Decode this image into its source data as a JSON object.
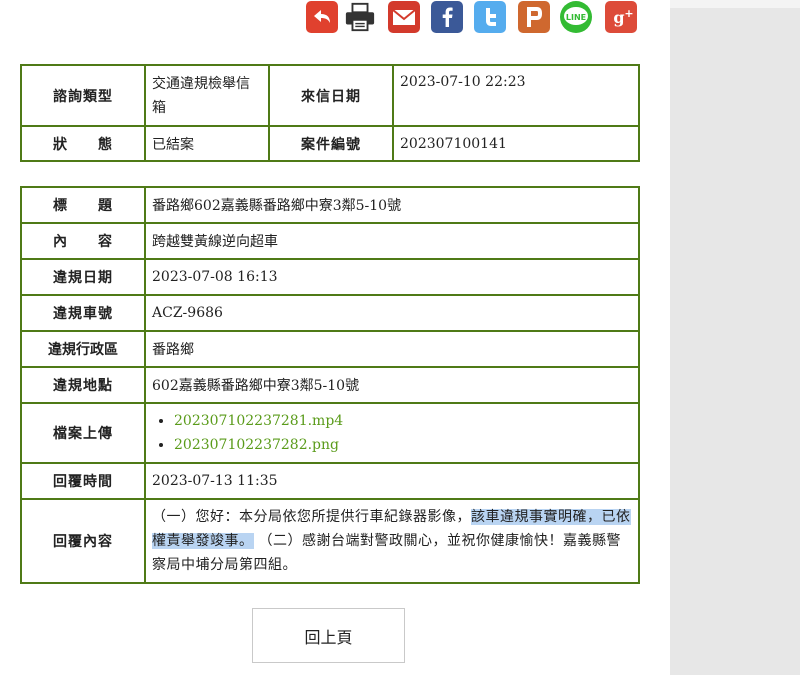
{
  "share_icons": [
    {
      "name": "back-arrow-icon",
      "color": "#e0412e",
      "glyph": "↶"
    },
    {
      "name": "print-icon",
      "color": "#ffffff",
      "glyph": "🖨"
    },
    {
      "name": "email-icon",
      "color": "#d33a2c",
      "glyph": "✉"
    },
    {
      "name": "facebook-icon",
      "color": "#3b5998",
      "glyph": "f"
    },
    {
      "name": "twitter-icon",
      "color": "#55acee",
      "glyph": "t"
    },
    {
      "name": "plurk-icon",
      "color": "#cf682f",
      "glyph": "P"
    },
    {
      "name": "line-icon",
      "color": "#33bb33",
      "glyph": "LINE"
    },
    {
      "name": "google-plus-icon",
      "color": "#dd4b39",
      "glyph": "g+"
    }
  ],
  "summary": {
    "category_label": "諮詢類型",
    "category_value": "交通違規檢舉信箱",
    "date_label": "來信日期",
    "date_value": "2023-07-10 22:23",
    "status_label": "狀　　態",
    "status_value": "已結案",
    "case_label": "案件編號",
    "case_value": "202307100141"
  },
  "detail": {
    "title_label": "標　　題",
    "title_value": "番路鄉602嘉義縣番路鄉中寮3鄰5-10號",
    "content_label": "內　　容",
    "content_value": "跨越雙黃線逆向超車",
    "vdate_label": "違規日期",
    "vdate_value": "2023-07-08 16:13",
    "plate_label": "違規車號",
    "plate_value": "ACZ-9686",
    "district_label": "違規行政區",
    "district_value": "番路鄉",
    "location_label": "違規地點",
    "location_value": "602嘉義縣番路鄉中寮3鄰5-10號",
    "files_label": "檔案上傳",
    "files": [
      "202307102237281.mp4",
      "202307102237282.png"
    ],
    "reply_time_label": "回覆時間",
    "reply_time_value": "2023-07-13 11:35",
    "reply_label": "回覆內容",
    "reply_part1": "（一）您好：本分局依您所提供行車紀錄器影像，",
    "reply_highlight": "該車違規事實明確，已依權責舉發竣事。",
    "reply_part2": "（二）感謝台端對警政關心，並祝你健康愉快！嘉義縣警察局中埔分局第四組。"
  },
  "back_button_label": "回上頁"
}
